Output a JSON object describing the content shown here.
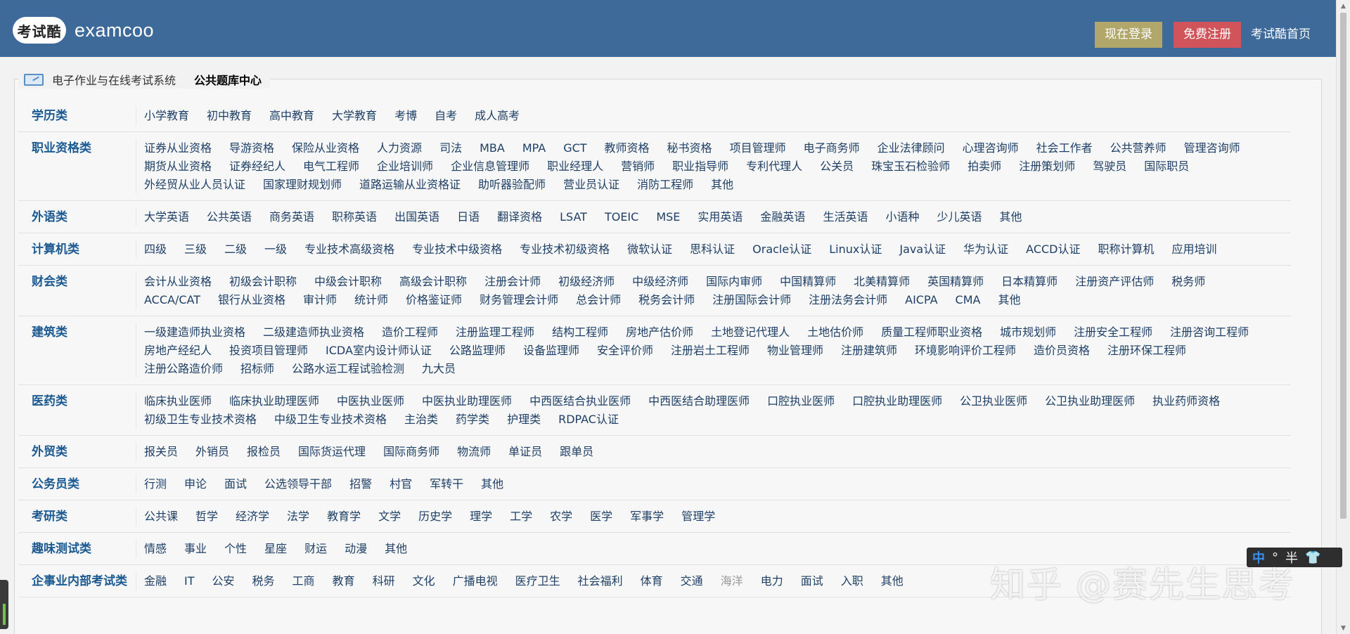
{
  "header": {
    "logo_badge": "考试酷",
    "logo_text": "examcoo",
    "login_label": "现在登录",
    "register_label": "免费注册",
    "home_label": "考试酷首页"
  },
  "breadcrumb": {
    "link_label": "电子作业与在线考试系统",
    "current_label": "公共题库中心"
  },
  "categories": [
    {
      "label": "学历类",
      "items": [
        "小学教育",
        "初中教育",
        "高中教育",
        "大学教育",
        "考博",
        "自考",
        "成人高考"
      ]
    },
    {
      "label": "职业资格类",
      "items": [
        "证券从业资格",
        "导游资格",
        "保险从业资格",
        "人力资源",
        "司法",
        "MBA",
        "MPA",
        "GCT",
        "教师资格",
        "秘书资格",
        "项目管理师",
        "电子商务师",
        "企业法律顾问",
        "心理咨询师",
        "社会工作者",
        "公共营养师",
        "管理咨询师",
        "期货从业资格",
        "证券经纪人",
        "电气工程师",
        "企业培训师",
        "企业信息管理师",
        "职业经理人",
        "营销师",
        "职业指导师",
        "专利代理人",
        "公关员",
        "珠宝玉石检验师",
        "拍卖师",
        "注册策划师",
        "驾驶员",
        "国际职员",
        "外经贸从业人员认证",
        "国家理财规划师",
        "道路运输从业资格证",
        "助听器验配师",
        "营业员认证",
        "消防工程师",
        "其他"
      ]
    },
    {
      "label": "外语类",
      "items": [
        "大学英语",
        "公共英语",
        "商务英语",
        "职称英语",
        "出国英语",
        "日语",
        "翻译资格",
        "LSAT",
        "TOEIC",
        "MSE",
        "实用英语",
        "金融英语",
        "生活英语",
        "小语种",
        "少儿英语",
        "其他"
      ]
    },
    {
      "label": "计算机类",
      "items": [
        "四级",
        "三级",
        "二级",
        "一级",
        "专业技术高级资格",
        "专业技术中级资格",
        "专业技术初级资格",
        "微软认证",
        "思科认证",
        "Oracle认证",
        "Linux认证",
        "Java认证",
        "华为认证",
        "ACCD认证",
        "职称计算机",
        "应用培训"
      ]
    },
    {
      "label": "财会类",
      "items": [
        "会计从业资格",
        "初级会计职称",
        "中级会计职称",
        "高级会计职称",
        "注册会计师",
        "初级经济师",
        "中级经济师",
        "国际内审师",
        "中国精算师",
        "北美精算师",
        "英国精算师",
        "日本精算师",
        "注册资产评估师",
        "税务师",
        "ACCA/CAT",
        "银行从业资格",
        "审计师",
        "统计师",
        "价格鉴证师",
        "财务管理会计师",
        "总会计师",
        "税务会计师",
        "注册国际会计师",
        "注册法务会计师",
        "AICPA",
        "CMA",
        "其他"
      ]
    },
    {
      "label": "建筑类",
      "items": [
        "一级建造师执业资格",
        "二级建造师执业资格",
        "造价工程师",
        "注册监理工程师",
        "结构工程师",
        "房地产估价师",
        "土地登记代理人",
        "土地估价师",
        "质量工程师职业资格",
        "城市规划师",
        "注册安全工程师",
        "注册咨询工程师",
        "房地产经纪人",
        "投资项目管理师",
        "ICDA室内设计师认证",
        "公路监理师",
        "设备监理师",
        "安全评价师",
        "注册岩土工程师",
        "物业管理师",
        "注册建筑师",
        "环境影响评价工程师",
        "造价员资格",
        "注册环保工程师",
        "注册公路造价师",
        "招标师",
        "公路水运工程试验检测",
        "九大员"
      ]
    },
    {
      "label": "医药类",
      "items": [
        "临床执业医师",
        "临床执业助理医师",
        "中医执业医师",
        "中医执业助理医师",
        "中西医结合执业医师",
        "中西医结合助理医师",
        "口腔执业医师",
        "口腔执业助理医师",
        "公卫执业医师",
        "公卫执业助理医师",
        "执业药师资格",
        "初级卫生专业技术资格",
        "中级卫生专业技术资格",
        "主治类",
        "药学类",
        "护理类",
        "RDPAC认证"
      ]
    },
    {
      "label": "外贸类",
      "items": [
        "报关员",
        "外销员",
        "报检员",
        "国际货运代理",
        "国际商务师",
        "物流师",
        "单证员",
        "跟单员"
      ]
    },
    {
      "label": "公务员类",
      "items": [
        "行测",
        "申论",
        "面试",
        "公选领导干部",
        "招警",
        "村官",
        "军转干",
        "其他"
      ]
    },
    {
      "label": "考研类",
      "items": [
        "公共课",
        "哲学",
        "经济学",
        "法学",
        "教育学",
        "文学",
        "历史学",
        "理学",
        "工学",
        "农学",
        "医学",
        "军事学",
        "管理学"
      ]
    },
    {
      "label": "趣味测试类",
      "items": [
        "情感",
        "事业",
        "个性",
        "星座",
        "财运",
        "动漫",
        "其他"
      ]
    },
    {
      "label": "企事业内部考试类",
      "items": [
        "金融",
        "IT",
        "公安",
        "税务",
        "工商",
        "教育",
        "科研",
        "文化",
        "广播电视",
        "医疗卫生",
        "社会福利",
        "体育",
        "交通",
        "海洋",
        "电力",
        "面试",
        "入职",
        "其他"
      ]
    }
  ],
  "ime": {
    "mode": "中",
    "punct": "°",
    "width": "半",
    "icon": "shirt-icon"
  },
  "watermark": "知乎 @赛先生思考",
  "colors": {
    "header_bg": "#3d6a99",
    "login_btn": "#b1a76a",
    "register_btn": "#d2545b",
    "category_label": "#1c5a92",
    "link": "#1e3f66"
  }
}
